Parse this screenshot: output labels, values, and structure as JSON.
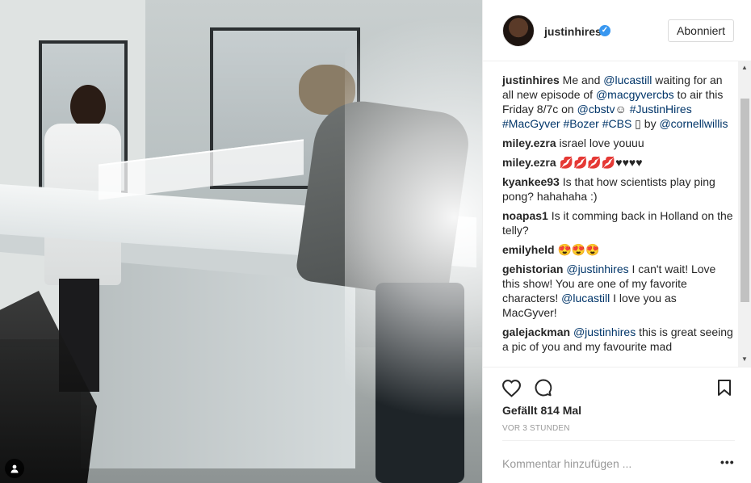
{
  "photo": {
    "alt_icon": "user-tag-icon"
  },
  "header": {
    "username": "justinhires",
    "verified_icon": "verified-badge-icon",
    "follow_label": "Abonniert"
  },
  "comments": [
    {
      "user": "justinhires",
      "parts": [
        {
          "t": " Me and "
        },
        {
          "t": "@lucastill",
          "link": true
        },
        {
          "t": " waiting for an all new episode of "
        },
        {
          "t": "@macgyvercbs",
          "link": true
        },
        {
          "t": " to air this Friday 8/7c on "
        },
        {
          "t": "@cbstv",
          "link": true
        },
        {
          "t": "☺ "
        },
        {
          "t": "#JustinHires",
          "link": true
        },
        {
          "t": " "
        },
        {
          "t": "#MacGyver",
          "link": true
        },
        {
          "t": " "
        },
        {
          "t": "#Bozer",
          "link": true
        },
        {
          "t": " "
        },
        {
          "t": "#CBS",
          "link": true
        },
        {
          "t": " ▯ by "
        },
        {
          "t": "@cornellwillis",
          "link": true
        }
      ]
    },
    {
      "user": "miley.ezra",
      "parts": [
        {
          "t": " israel love youuu"
        }
      ]
    },
    {
      "user": "miley.ezra",
      "parts": [
        {
          "t": " 💋💋💋💋♥♥♥♥"
        }
      ]
    },
    {
      "user": "kyankee93",
      "parts": [
        {
          "t": " Is that how scientists play ping pong? hahahaha :)"
        }
      ]
    },
    {
      "user": "noapas1",
      "parts": [
        {
          "t": " Is it comming back in Holland on the telly?"
        }
      ]
    },
    {
      "user": "emilyheld",
      "parts": [
        {
          "t": " 😍😍😍"
        }
      ]
    },
    {
      "user": "gehistorian",
      "parts": [
        {
          "t": " "
        },
        {
          "t": "@justinhires",
          "link": true
        },
        {
          "t": " I can't wait! Love this show! You are one of my favorite characters! "
        },
        {
          "t": "@lucastill",
          "link": true
        },
        {
          "t": " I love you as MacGyver!"
        }
      ]
    },
    {
      "user": "galejackman",
      "parts": [
        {
          "t": " "
        },
        {
          "t": "@justinhires",
          "link": true
        },
        {
          "t": " this is great seeing a pic of you and my favourite mad"
        }
      ]
    }
  ],
  "actions": {
    "like_icon": "heart-icon",
    "comment_icon": "comment-bubble-icon",
    "save_icon": "bookmark-icon"
  },
  "likes_text": "Gefällt 814 Mal",
  "time_text": "VOR 3 STUNDEN",
  "add_comment": {
    "placeholder": "Kommentar hinzufügen ...",
    "more_label": "•••"
  },
  "colors": {
    "link": "#003569",
    "verified": "#3897f0",
    "text": "#262626",
    "muted": "#999999"
  }
}
